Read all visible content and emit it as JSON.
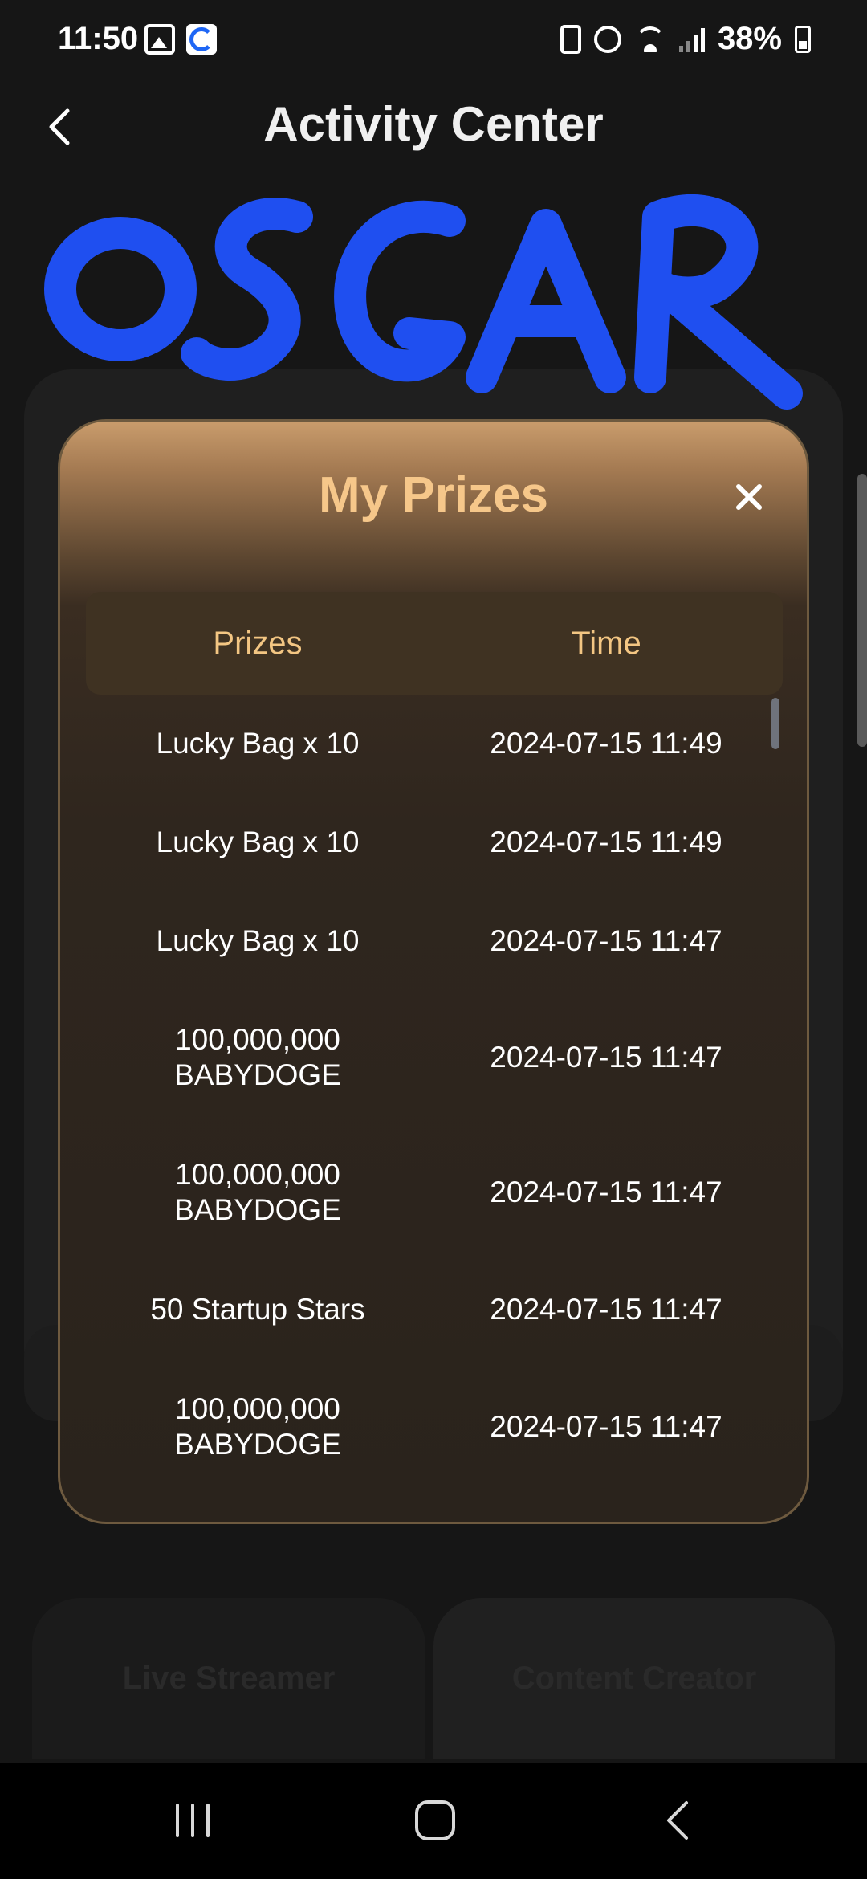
{
  "status_bar": {
    "time": "11:50",
    "battery_percent": "38%"
  },
  "header": {
    "title": "Activity Center",
    "back_icon": "chevron-left-icon"
  },
  "watermark": {
    "text": "OSGAR",
    "color": "#1f4ff0"
  },
  "background": {
    "tab_live_streamer": "Live Streamer",
    "tab_content_creator": "Content Creator"
  },
  "modal": {
    "title": "My Prizes",
    "close_icon": "close-icon",
    "columns": {
      "prizes": "Prizes",
      "time": "Time"
    },
    "rows": [
      {
        "prize": "Lucky Bag x 10",
        "time": "2024-07-15 11:49"
      },
      {
        "prize": "Lucky Bag x 10",
        "time": "2024-07-15 11:49"
      },
      {
        "prize": "Lucky Bag x 10",
        "time": "2024-07-15 11:47"
      },
      {
        "prize": "100,000,000\nBABYDOGE",
        "time": "2024-07-15 11:47"
      },
      {
        "prize": "100,000,000\nBABYDOGE",
        "time": "2024-07-15 11:47"
      },
      {
        "prize": "50 Startup Stars",
        "time": "2024-07-15 11:47"
      },
      {
        "prize": "100,000,000\nBABYDOGE",
        "time": "2024-07-15 11:47"
      }
    ],
    "accent_color": "#f3c683"
  },
  "nav_bar": {
    "recent_icon": "recent-apps-icon",
    "home_icon": "home-icon",
    "back_icon": "back-icon"
  }
}
